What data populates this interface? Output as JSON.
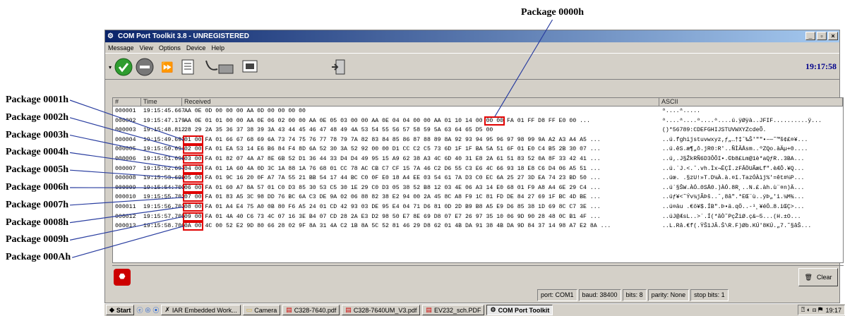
{
  "annotations": {
    "top_label": "Package 0000h",
    "left_labels": [
      "Package 0001h",
      "Package 0002h",
      "Package 0003h",
      "Package 0004h",
      "Package 0005h",
      "Package 0006h",
      "Package 0007h",
      "Package 0008h",
      "Package 0009h",
      "Package 000Ah"
    ]
  },
  "window": {
    "title": "COM Port Toolkit 3.8 - UNREGISTERED",
    "menu": [
      "Message",
      "View",
      "Options",
      "Device",
      "Help"
    ],
    "clock": "19:17:58"
  },
  "grid": {
    "headers": [
      "#",
      "Time",
      "Received",
      "ASCII"
    ],
    "rows": [
      {
        "num": "000001",
        "time": "19:15:45.667",
        "pre": "",
        "hl": "",
        "recv": "AA 0E 0D 00 00 00 AA 0D 00 00 00 00",
        "ascii": "ª....ª....."
      },
      {
        "num": "000002",
        "time": "19:15:47.179",
        "pre": "AA 0E 01 01 00 00 AA 0E 06 02 00 00 AA 0E 05 03 00 00 AA 0E 04 04 00 00 AA 01 10 14 00 ",
        "hl": "00 00",
        "recv": " FA 01 FF D8 FF E0 00 ...",
        "ascii": "ª....ª....ª....ª....ú.ÿØÿà..JFIF..........ÿ..."
      },
      {
        "num": "000003",
        "time": "19:15:48.812",
        "pre": "",
        "hl": "",
        "recv": "28 29 2A 35 36 37 38 39 3A 43 44 45 46 47 48 49 4A 53 54 55 56 57 58 59 5A 63 64 65 D5 00",
        "ascii": "()*56789:CDEFGHIJSTUVWXYZcdeÕ."
      },
      {
        "num": "000004",
        "time": "19:15:49.693",
        "pre": "",
        "hl": "01 00",
        "recv": " FA 01 66 67 68 69 6A 73 74 75 76 77 78 79 7A 82 83 84 85 86 87 88 89 8A 92 93 94 95 96 97 98 99 9A A2 A3 A4 A5 ...",
        "ascii": "..ú.fghijstuvwxyz‚ƒ„…†‡ˆ‰Š'\"\"•–—˜™š¢£¤¥..."
      },
      {
        "num": "000005",
        "time": "19:15:50.694",
        "pre": "",
        "hl": "02 00",
        "recv": " FA 01 EA 53 14 E6 B6 84 F4 8D 6A 52 30 3A 52 92 00 00 D1 CC C2 C5 73 6D 1F 1F BA 5A 51 6F 01 E0 C4 B5 2B 30 07 ...",
        "ascii": "..ú.êS.æ¶„ô.jR0:R'..ÑÌÂÅsm..ºZQo.àÄµ+0...."
      },
      {
        "num": "000006",
        "time": "19:15:51.696",
        "pre": "",
        "hl": "03 00",
        "recv": " FA 01 82 07 4A A7 8E 6B 52 D1 36 44 33 D4 D4 49 95 15 A9 62 38 A3 4C 6D 40 31 E8 2A 61 51 83 52 0A 8F 33 42 41 ...",
        "ascii": "..ú‚.J§ŽkRÑ6D3ÔÔI•.©b8£Lm@1è*aQƒR..3BA..."
      },
      {
        "num": "000007",
        "time": "19:15:52.697",
        "pre": "",
        "hl": "04 00",
        "recv": " FA 01 1A 60 4A 0D 3C 1A 88 1A 76 68 01 CC 78 AC CB C7 CF 15 7A 46 C2 D6 55 C3 E6 4C 66 93 18 E8 C6 D4 06 A5 51 ...",
        "ascii": "..ú.`J.<.ˆ.vh.Ìx¬ËÇÏ.zFÂÖUÃæLf\".èÆÔ.¥Q..."
      },
      {
        "num": "000008",
        "time": "19:15:53.699",
        "pre": "",
        "hl": "05 00",
        "recv": " FA 01 9C 16 20 0F A7 7A 55 21 BB 54 17 44 BC C0 0F E0 18 A4 EE 03 54 61 7A D3 C0 EC 6A 25 27 3D EA 74 23 BD 50 ...",
        "ascii": "..úœ. .§zU!»T.D¼À.à.¤î.TazÓÀìj%'=êt#½P..."
      },
      {
        "num": "000009",
        "time": "19:15:54:700",
        "pre": "",
        "hl": "06 00",
        "recv": " FA 01 60 A7 8A 57 01 C0 D3 85 30 53 C5 30 1E 29 C0 D3 05 38 52 B8 12 03 4E 06 A3 14 E0 68 01 F9 A8 A4 6E 29 C4 ...",
        "ascii": "..ú`§ŠW.ÀÓ…0SÅ0.)ÀÓ.8R¸..N.£.àh.ù¨¤n)Ä..."
      },
      {
        "num": "000010",
        "time": "19:15:55.702",
        "pre": "",
        "hl": "07 00",
        "recv": " FA 01 83 A5 3C 98 DD 76 BC 6A C3 DE 9A 02 06 88 82 38 E2 94 00 2A 45 8C A8 F9 1C 81 FD DE 84 27 69 1F BC 4D BE ...",
        "ascii": "..úƒ¥<˜Ýv¼jÃÞš..ˆ‚8â\".*EŒ¨ù..ýÞ„'i.¼M¾..."
      },
      {
        "num": "000011",
        "time": "19:15:56.703",
        "pre": "",
        "hl": "08 00",
        "recv": " FA 01 A4 E4 75 A0 0B 80 F6 A5 24 01 CD 42 93 03 DE 95 E4 04 71 D6 81 0D 2D B9 B8 A5 E9 D6 85 38 1D 69 8C C7 3E ...",
        "ascii": "..ú¤äu .€ö¥$.ÍB\".Þ•ä.qÖ..-¹¸¥éÖ…8.iŒÇ>..."
      },
      {
        "num": "000012",
        "time": "19:15:57.705",
        "pre": "",
        "hl": "09 00",
        "recv": " FA 01 4A 40 C6 73 4C 07 16 3E B4 07 CD 28 2A E3 D2 98 50 E7 8E 69 D8 07 E7 26 97 35 10 06 9D 90 28 48 0C B1 4F ...",
        "ascii": "..úJ@ÆsL..>´.Í(*ãÒ˜PçŽiØ.ç&—5...(H.±O..."
      },
      {
        "num": "000013",
        "time": "19:15:58.706",
        "pre": "",
        "hl": "0A 00",
        "recv": " 4C 00 52 E2 9D 80 66 28 02 9F 8A 31 4A C2 1B 8A 5C 52 81 46 29 D8 62 01 4B DA 91 38 4B DA 9D 84 37 14 98 A7 E2 8A ...",
        "ascii": "..L.Râ.€f(.ŸŠ1JÂ.Š\\R.F)Øb.KÚ'8KÚ.„7.˜§âŠ..."
      }
    ]
  },
  "bottom": {
    "clear_label": "Clear"
  },
  "status": [
    "port: COM1",
    "baud: 38400",
    "bits: 8",
    "parity: None",
    "stop bits: 1"
  ],
  "taskbar": {
    "start": "Start",
    "tasks": [
      "IAR Embedded Work...",
      "Camera",
      "C328-7640.pdf",
      "C328-7640UM_V3.pdf",
      "EV232_sch.PDF",
      "COM Port Toolkit"
    ],
    "time": "19:17"
  }
}
